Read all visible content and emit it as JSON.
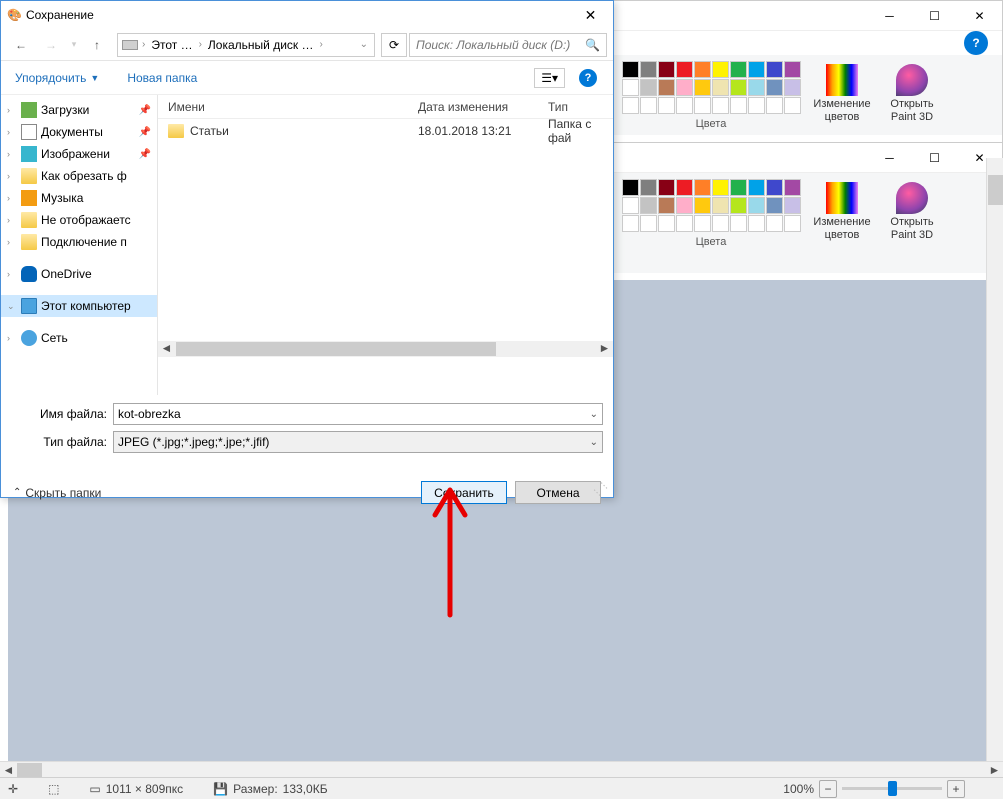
{
  "dialog": {
    "title": "Сохранение",
    "nav": {
      "path_parts": [
        "Этот …",
        "Локальный диск …"
      ],
      "refresh_icon": "refresh-icon",
      "search_placeholder": "Поиск: Локальный диск (D:)"
    },
    "toolbar": {
      "organize": "Упорядочить",
      "new_folder": "Новая папка"
    },
    "tree": [
      {
        "icon": "download",
        "label": "Загрузки",
        "pin": true
      },
      {
        "icon": "doc",
        "label": "Документы",
        "pin": true
      },
      {
        "icon": "img",
        "label": "Изображени",
        "pin": true
      },
      {
        "icon": "folder",
        "label": "Как обрезать ф"
      },
      {
        "icon": "music",
        "label": "Музыка"
      },
      {
        "icon": "folder",
        "label": "Не отображаетс"
      },
      {
        "icon": "folder",
        "label": "Подключение п"
      },
      {
        "spacer": true
      },
      {
        "icon": "onedrive",
        "label": "OneDrive"
      },
      {
        "spacer": true
      },
      {
        "icon": "pc",
        "label": "Этот компьютер",
        "selected": true
      },
      {
        "spacer": true
      },
      {
        "icon": "net",
        "label": "Сеть"
      }
    ],
    "list": {
      "headers": {
        "name": "Имени",
        "date": "Дата изменения",
        "type": "Тип"
      },
      "rows": [
        {
          "name": "Статьи",
          "date": "18.01.2018 13:21",
          "type": "Папка с фай"
        }
      ]
    },
    "fields": {
      "filename_label": "Имя файла:",
      "filename_value": "kot-obrezka",
      "filetype_label": "Тип файла:",
      "filetype_value": "JPEG (*.jpg;*.jpeg;*.jpe;*.jfif)"
    },
    "footer": {
      "hide_folders": "Скрыть папки",
      "save": "Сохранить",
      "cancel": "Отмена"
    }
  },
  "ribbon": {
    "colors_label": "Цвета",
    "edit_colors": "Изменение цветов",
    "paint3d": "Открыть Paint 3D",
    "palette_row1": [
      "#000000",
      "#7f7f7f",
      "#880015",
      "#ed1c24",
      "#ff7f27",
      "#fff200",
      "#22b14c",
      "#00a2e8",
      "#3f48cc",
      "#a349a4"
    ],
    "palette_row2": [
      "#ffffff",
      "#c3c3c3",
      "#b97a57",
      "#ffaec9",
      "#ffc90e",
      "#efe4b0",
      "#b5e61d",
      "#99d9ea",
      "#7092be",
      "#c8bfe7"
    ],
    "palette_row3": [
      "#fff",
      "#fff",
      "#fff",
      "#fff",
      "#fff",
      "#fff",
      "#fff",
      "#fff",
      "#fff",
      "#fff"
    ]
  },
  "status": {
    "dims": "1011 × 809пкс",
    "size_label": "Размер:",
    "size": "133,0КБ",
    "zoom": "100%"
  }
}
